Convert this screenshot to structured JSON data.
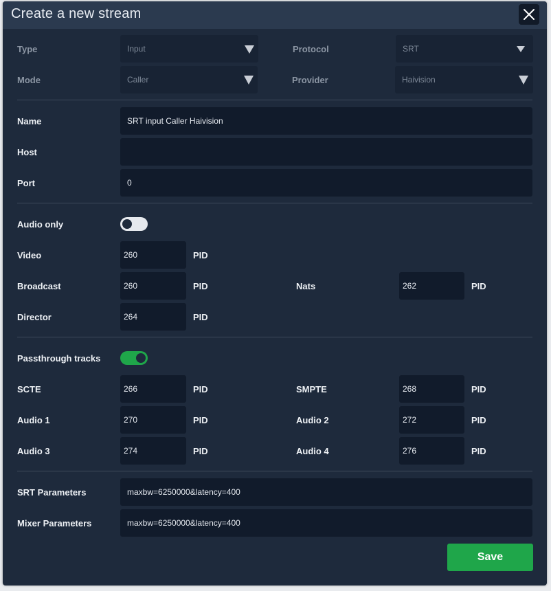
{
  "dialog": {
    "title": "Create a new stream",
    "close_icon": "close-icon"
  },
  "type_row": {
    "type_label": "Type",
    "type_value": "Input",
    "protocol_label": "Protocol",
    "protocol_value": "SRT"
  },
  "mode_row": {
    "mode_label": "Mode",
    "mode_value": "Caller",
    "provider_label": "Provider",
    "provider_value": "Haivision"
  },
  "name": {
    "label": "Name",
    "value": "SRT input Caller Haivision"
  },
  "host": {
    "label": "Host",
    "value": ""
  },
  "port": {
    "label": "Port",
    "value": "0"
  },
  "audio_only": {
    "label": "Audio only",
    "enabled": false
  },
  "video": {
    "label": "Video",
    "value": "260",
    "unit": "PID"
  },
  "broadcast": {
    "label": "Broadcast",
    "value": "260",
    "unit": "PID"
  },
  "nats": {
    "label": "Nats",
    "value": "262",
    "unit": "PID"
  },
  "director": {
    "label": "Director",
    "value": "264",
    "unit": "PID"
  },
  "passthrough": {
    "label": "Passthrough tracks",
    "enabled": true
  },
  "scte": {
    "label": "SCTE",
    "value": "266",
    "unit": "PID"
  },
  "smpte": {
    "label": "SMPTE",
    "value": "268",
    "unit": "PID"
  },
  "audio1": {
    "label": "Audio 1",
    "value": "270",
    "unit": "PID"
  },
  "audio2": {
    "label": "Audio 2",
    "value": "272",
    "unit": "PID"
  },
  "audio3": {
    "label": "Audio 3",
    "value": "274",
    "unit": "PID"
  },
  "audio4": {
    "label": "Audio 4",
    "value": "276",
    "unit": "PID"
  },
  "srt_params": {
    "label": "SRT Parameters",
    "value": "maxbw=6250000&latency=400"
  },
  "mixer_params": {
    "label": "Mixer Parameters",
    "value": "maxbw=6250000&latency=400"
  },
  "actions": {
    "save_label": "Save"
  },
  "colors": {
    "accent": "#1fa64a",
    "background": "#1e2a3c",
    "field": "#111b2b",
    "toggle_off": "#e6e9ee"
  }
}
